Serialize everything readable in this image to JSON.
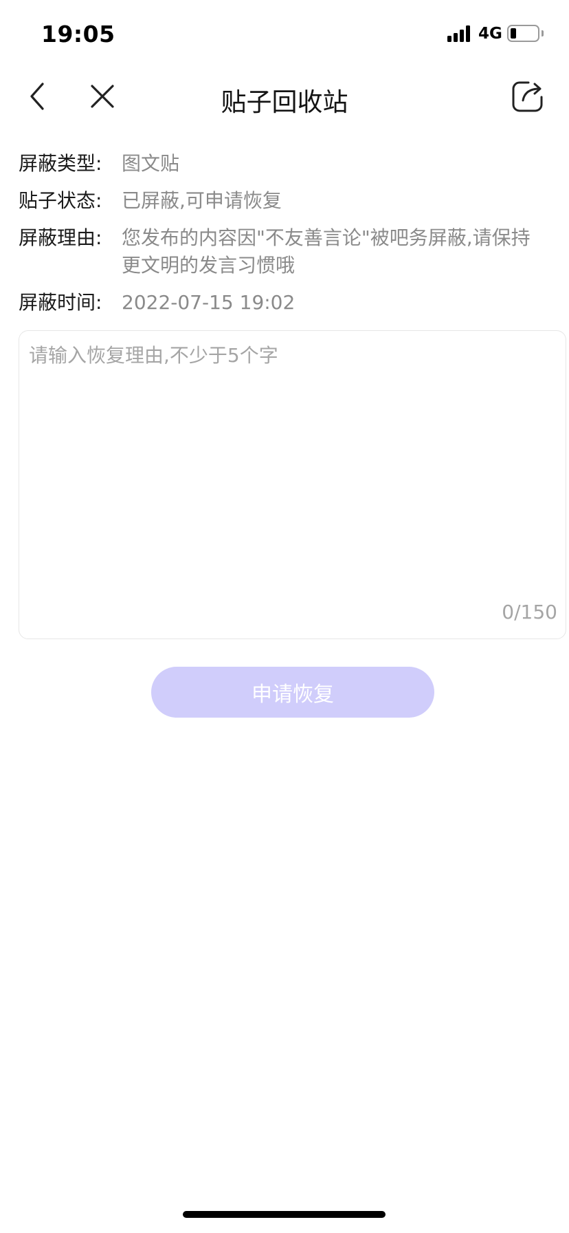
{
  "status_bar": {
    "time": "19:05",
    "network": "4G",
    "battery_level": 0.2,
    "icons": [
      "signal-icon",
      "battery-icon"
    ]
  },
  "nav": {
    "title": "贴子回收站",
    "icons": [
      "back-icon",
      "close-icon",
      "share-icon"
    ]
  },
  "info": {
    "type_label": "屏蔽类型:",
    "type_value": "图文贴",
    "status_label": "贴子状态:",
    "status_value": "已屏蔽,可申请恢复",
    "reason_label": "屏蔽理由:",
    "reason_value": "您发布的内容因\"不友善言论\"被吧务屏蔽,请保持更文明的发言习惯哦",
    "time_label": "屏蔽时间:",
    "time_value": "2022-07-15 19:02"
  },
  "form": {
    "placeholder": "请输入恢复理由,不少于5个字",
    "value": "",
    "char_count": "0/150",
    "submit_label": "申请恢复",
    "submit_color": "#d0cdfb"
  }
}
